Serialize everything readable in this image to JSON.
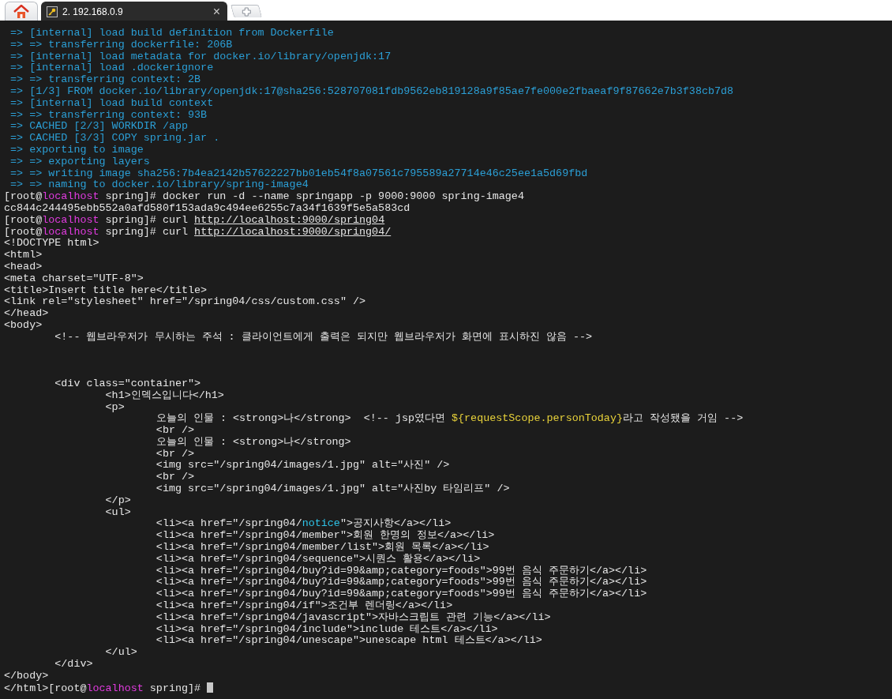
{
  "tabs": [
    {
      "kind": "home",
      "selected": false
    },
    {
      "kind": "session",
      "label": "2. 192.168.0.9",
      "close": "×",
      "selected": true
    },
    {
      "kind": "new"
    }
  ],
  "terminal": {
    "lines": [
      {
        "segments": [
          {
            "text": " => [internal] load build definition from Dockerfile",
            "kind": "blue"
          }
        ]
      },
      {
        "segments": [
          {
            "text": " => => transferring dockerfile: 206B",
            "kind": "blue"
          }
        ]
      },
      {
        "segments": [
          {
            "text": " => [internal] load metadata for docker.io/library/openjdk:17",
            "kind": "blue"
          }
        ]
      },
      {
        "segments": [
          {
            "text": " => [internal] load .dockerignore",
            "kind": "blue"
          }
        ]
      },
      {
        "segments": [
          {
            "text": " => => transferring context: 2B",
            "kind": "blue"
          }
        ]
      },
      {
        "segments": [
          {
            "text": " => [1/3] FROM docker.io/library/openjdk:17@sha256:528707081fdb9562eb819128a9f85ae7fe000e2fbaeaf9f87662e7b3f38cb7d8",
            "kind": "blue"
          }
        ]
      },
      {
        "segments": [
          {
            "text": " => [internal] load build context",
            "kind": "blue"
          }
        ]
      },
      {
        "segments": [
          {
            "text": " => => transferring context: 93B",
            "kind": "blue"
          }
        ]
      },
      {
        "segments": [
          {
            "text": " => CACHED [2/3] WORKDIR /app",
            "kind": "blue"
          }
        ]
      },
      {
        "segments": [
          {
            "text": " => CACHED [3/3] COPY spring.jar .",
            "kind": "blue"
          }
        ]
      },
      {
        "segments": [
          {
            "text": " => exporting to image",
            "kind": "blue"
          }
        ]
      },
      {
        "segments": [
          {
            "text": " => => exporting layers",
            "kind": "blue"
          }
        ]
      },
      {
        "segments": [
          {
            "text": " => => writing image sha256:7b4ea2142b57622227bb01eb54f8a07561c795589a27714e46c25ee1a5d69fbd",
            "kind": "blue"
          }
        ]
      },
      {
        "segments": [
          {
            "text": " => => naming to docker.io/library/spring-image4",
            "kind": "blue"
          }
        ]
      },
      {
        "segments": [
          {
            "text": "[root@",
            "kind": "plain"
          },
          {
            "text": "localhost",
            "kind": "host"
          },
          {
            "text": " spring]# docker run -d --name springapp -p 9000:9000 spring-image4",
            "kind": "plain"
          }
        ]
      },
      {
        "segments": [
          {
            "text": "cc844c244495ebb552a0afd580f153ada9c494ee6255c7a34f1639f5e5a583cd",
            "kind": "plain"
          }
        ]
      },
      {
        "segments": [
          {
            "text": "[root@",
            "kind": "plain"
          },
          {
            "text": "localhost",
            "kind": "host"
          },
          {
            "text": " spring]# curl ",
            "kind": "plain"
          },
          {
            "text": "http://localhost:9000/spring04",
            "kind": "url"
          }
        ]
      },
      {
        "segments": [
          {
            "text": "[root@",
            "kind": "plain"
          },
          {
            "text": "localhost",
            "kind": "host"
          },
          {
            "text": " spring]# curl ",
            "kind": "plain"
          },
          {
            "text": "http://localhost:9000/spring04/",
            "kind": "url"
          }
        ]
      },
      {
        "segments": [
          {
            "text": "<!DOCTYPE html>",
            "kind": "plain"
          }
        ]
      },
      {
        "segments": [
          {
            "text": "<html>",
            "kind": "plain"
          }
        ]
      },
      {
        "segments": [
          {
            "text": "<head>",
            "kind": "plain"
          }
        ]
      },
      {
        "segments": [
          {
            "text": "<meta charset=\"UTF-8\">",
            "kind": "plain"
          }
        ]
      },
      {
        "segments": [
          {
            "text": "<title>Insert title here</title>",
            "kind": "plain"
          }
        ]
      },
      {
        "segments": [
          {
            "text": "<link rel=\"stylesheet\" href=\"/spring04/css/custom.css\" />",
            "kind": "plain"
          }
        ]
      },
      {
        "segments": [
          {
            "text": "</head>",
            "kind": "plain"
          }
        ]
      },
      {
        "segments": [
          {
            "text": "<body>",
            "kind": "plain"
          }
        ]
      },
      {
        "segments": [
          {
            "text": "\t<!-- 웹브라우저가 무시하는 주석 : 클라이언트에게 출력은 되지만 웹브라우저가 화면에 표시하진 않음 -->",
            "kind": "plain"
          }
        ]
      },
      {
        "segments": [
          {
            "text": "\n\n\n\t<div class=\"container\">",
            "kind": "plain"
          }
        ]
      },
      {
        "segments": [
          {
            "text": "\t\t<h1>인덱스입니다</h1>",
            "kind": "plain"
          }
        ]
      },
      {
        "segments": [
          {
            "text": "\t\t<p>",
            "kind": "plain"
          }
        ]
      },
      {
        "segments": [
          {
            "text": "\t\t\t오늘의 인물 : <strong>나</strong>  <!-- jsp였다면 ",
            "kind": "plain"
          },
          {
            "text": "${requestScope.personToday}",
            "kind": "yellow"
          },
          {
            "text": "라고 작성됐을 거임 -->",
            "kind": "plain"
          }
        ]
      },
      {
        "segments": [
          {
            "text": "\t\t\t<br />",
            "kind": "plain"
          }
        ]
      },
      {
        "segments": [
          {
            "text": "\t\t\t오늘의 인물 : <strong>나</strong>",
            "kind": "plain"
          }
        ]
      },
      {
        "segments": [
          {
            "text": "\t\t\t<br />",
            "kind": "plain"
          }
        ]
      },
      {
        "segments": [
          {
            "text": "\t\t\t<img src=\"/spring04/images/1.jpg\" alt=\"사진\" />",
            "kind": "plain"
          }
        ]
      },
      {
        "segments": [
          {
            "text": "\t\t\t<br />",
            "kind": "plain"
          }
        ]
      },
      {
        "segments": [
          {
            "text": "\t\t\t<img src=\"/spring04/images/1.jpg\" alt=\"사진by 타임리프\" />",
            "kind": "plain"
          }
        ]
      },
      {
        "segments": [
          {
            "text": "\t\t</p>",
            "kind": "plain"
          }
        ]
      },
      {
        "segments": [
          {
            "text": "\t\t<ul>",
            "kind": "plain"
          }
        ]
      },
      {
        "segments": [
          {
            "text": "\t\t\t<li><a href=\"/spring04/",
            "kind": "plain"
          },
          {
            "text": "notice",
            "kind": "cyan"
          },
          {
            "text": "\">공지사항</a></li>",
            "kind": "plain"
          }
        ]
      },
      {
        "segments": [
          {
            "text": "\t\t\t<li><a href=\"/spring04/member\">회원 한명의 정보</a></li>",
            "kind": "plain"
          }
        ]
      },
      {
        "segments": [
          {
            "text": "\t\t\t<li><a href=\"/spring04/member/list\">회원 목록</a></li>",
            "kind": "plain"
          }
        ]
      },
      {
        "segments": [
          {
            "text": "\t\t\t<li><a href=\"/spring04/sequence\">시퀀스 활용</a></li>",
            "kind": "plain"
          }
        ]
      },
      {
        "segments": [
          {
            "text": "\t\t\t<li><a href=\"/spring04/buy?id=99&amp;category=foods\">99번 음식 주문하기</a></li>",
            "kind": "plain"
          }
        ]
      },
      {
        "segments": [
          {
            "text": "\t\t\t<li><a href=\"/spring04/buy?id=99&amp;category=foods\">99번 음식 주문하기</a></li>",
            "kind": "plain"
          }
        ]
      },
      {
        "segments": [
          {
            "text": "\t\t\t<li><a href=\"/spring04/buy?id=99&amp;category=foods\">99번 음식 주문하기</a></li>",
            "kind": "plain"
          }
        ]
      },
      {
        "segments": [
          {
            "text": "\t\t\t<li><a href=\"/spring04/if\">조건부 렌더링</a></li>",
            "kind": "plain"
          }
        ]
      },
      {
        "segments": [
          {
            "text": "\t\t\t<li><a href=\"/spring04/javascript\">자바스크립트 관련 기능</a></li>",
            "kind": "plain"
          }
        ]
      },
      {
        "segments": [
          {
            "text": "\t\t\t<li><a href=\"/spring04/include\">include 테스트</a></li>",
            "kind": "plain"
          }
        ]
      },
      {
        "segments": [
          {
            "text": "\t\t\t<li><a href=\"/spring04/unescape\">unescape html 테스트</a></li>",
            "kind": "plain"
          }
        ]
      },
      {
        "segments": [
          {
            "text": "\t\t</ul>",
            "kind": "plain"
          }
        ]
      },
      {
        "segments": [
          {
            "text": "\t</div>",
            "kind": "plain"
          }
        ]
      },
      {
        "segments": [
          {
            "text": "</body>",
            "kind": "plain"
          }
        ]
      },
      {
        "segments": [
          {
            "text": "</html>[root@",
            "kind": "plain"
          },
          {
            "text": "localhost",
            "kind": "host"
          },
          {
            "text": " spring]# ",
            "kind": "plain"
          }
        ],
        "cursor": true
      }
    ]
  }
}
